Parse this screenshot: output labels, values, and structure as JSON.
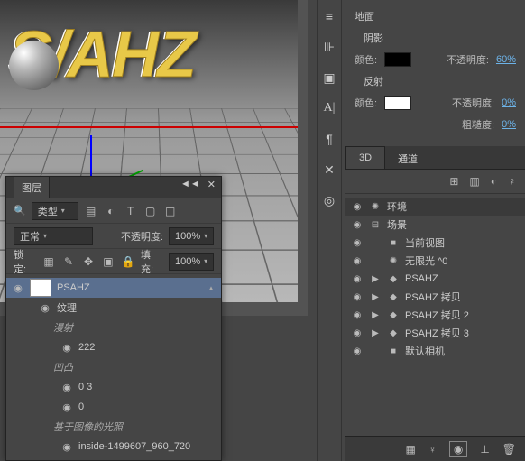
{
  "canvas": {
    "text3d": "S/AHZ"
  },
  "layers_panel": {
    "tab": "图层",
    "filter_label": "类型",
    "blend_mode": "正常",
    "opacity_label": "不透明度:",
    "opacity_value": "100%",
    "lock_label": "锁定:",
    "fill_label": "填充:",
    "fill_value": "100%",
    "tree": {
      "layer_name": "PSAHZ",
      "texture": "纹理",
      "diffuse": "漫射",
      "diffuse_val": "222",
      "bump": "凹凸",
      "bump_v1": "0 3",
      "bump_v2": "0",
      "ibl": "基于图像的光照",
      "ibl_item": "inside-1499607_960_720"
    }
  },
  "right": {
    "props": {
      "ground": "地面",
      "shadow": "阴影",
      "color_label": "颜色:",
      "shadow_opacity_label": "不透明度:",
      "shadow_opacity_val": "60%",
      "reflection": "反射",
      "refl_opacity_val": "0%",
      "roughness_label": "粗糙度:",
      "roughness_val": "0%"
    },
    "tabs": {
      "t1": "3D",
      "t2": "通道"
    },
    "tree": {
      "env": "环境",
      "scene": "场景",
      "current_view": "当前视图",
      "infinite_light": "无限光  ^0",
      "psahz": "PSAHZ",
      "copy1": "PSAHZ 拷贝",
      "copy2": "PSAHZ 拷贝 2",
      "copy3": "PSAHZ 拷贝 3",
      "default_cam": "默认相机"
    }
  }
}
